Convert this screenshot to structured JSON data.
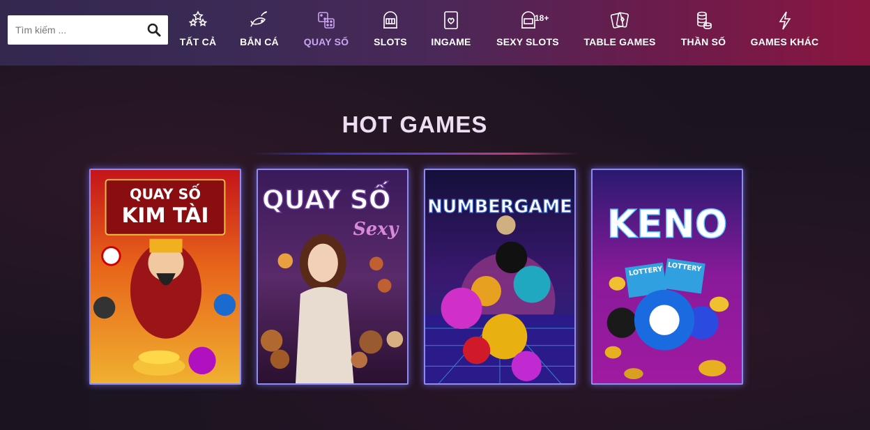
{
  "search": {
    "placeholder": "Tìm kiếm ..."
  },
  "nav": {
    "items": [
      {
        "label": "TẤT CẢ",
        "icon": "stars-icon"
      },
      {
        "label": "BẮN CÁ",
        "icon": "fish-icon"
      },
      {
        "label": "QUAY SỐ",
        "icon": "dice-icon",
        "active": true
      },
      {
        "label": "SLOTS",
        "icon": "slot-machine-icon"
      },
      {
        "label": "INGAME",
        "icon": "card-icon"
      },
      {
        "label": "SEXY SLOTS",
        "icon": "slot-machine-18-icon",
        "badge": "18+"
      },
      {
        "label": "TABLE GAMES",
        "icon": "playing-cards-icon"
      },
      {
        "label": "THẦN SỐ",
        "icon": "coin-stack-icon"
      },
      {
        "label": "GAMES KHÁC",
        "icon": "lightning-icon"
      }
    ]
  },
  "hot": {
    "title": "HOT GAMES",
    "games": [
      {
        "line1": "QUAY SỐ",
        "line2": "KIM TÀI"
      },
      {
        "line1": "QUAY SỐ",
        "line2": "Sexy"
      },
      {
        "line1": "NUMBERGAME"
      },
      {
        "line1": "KENO",
        "ticket": "LOTTERY"
      }
    ]
  },
  "colors": {
    "active_nav": "#c9a4f0",
    "card_border": "#8e8cf0"
  }
}
